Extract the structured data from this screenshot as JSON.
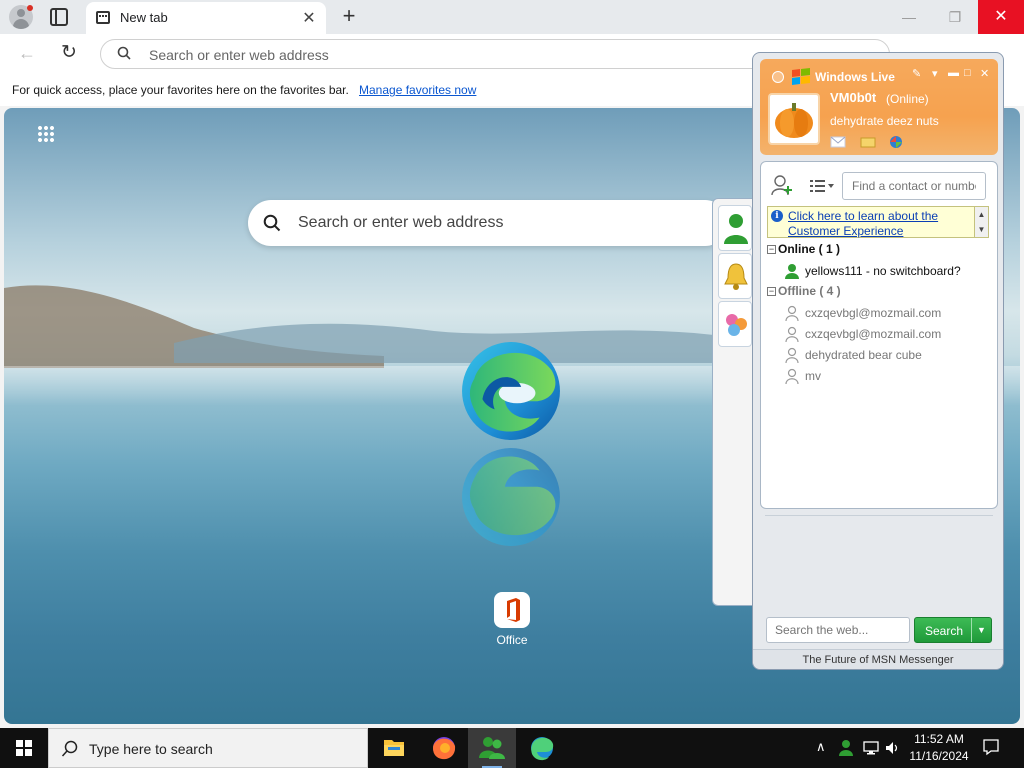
{
  "browser": {
    "tab_title": "New tab",
    "tab_close": "✕",
    "new_tab": "+",
    "win_min": "—",
    "win_max": "❐",
    "win_close": "✕",
    "address_placeholder": "Search or enter web address",
    "favorites_message": "For quick access, place your favorites here on the favorites bar.",
    "favorites_link": "Manage favorites now"
  },
  "ntp": {
    "search_placeholder": "Search or enter web address",
    "tiles": [
      {
        "label": "Office",
        "icon": "office-icon"
      }
    ]
  },
  "messenger": {
    "title": "Windows Live",
    "ctrl_dropdown": "▾",
    "ctrl_min": "▬",
    "ctrl_max": "□",
    "ctrl_close": "✕",
    "display_name": "VM0b0t",
    "status": "(Online)",
    "personal_message": "dehydrate deez nuts",
    "find_placeholder": "Find a contact or numbe",
    "info_link": "Click here to learn about the Customer Experience",
    "groups": [
      {
        "label": "Online ( 1 )",
        "toggle": "−",
        "contacts": [
          {
            "name": "yellows111 - no switchboard?",
            "state": "online"
          }
        ]
      },
      {
        "label": "Offline ( 4 )",
        "toggle": "−",
        "contacts": [
          {
            "name": "cxzqevbgl@mozmail.com",
            "state": "offline"
          },
          {
            "name": "cxzqevbgl@mozmail.com",
            "state": "offline"
          },
          {
            "name": "dehydrated bear cube",
            "state": "offline"
          },
          {
            "name": "mv",
            "state": "offline"
          }
        ]
      }
    ],
    "web_search_placeholder": "Search the web...",
    "web_search_button": "Search",
    "footer": "The Future of MSN Messenger"
  },
  "taskbar": {
    "search_placeholder": "Type here to search",
    "apps": [
      "file-explorer-icon",
      "firefox-icon",
      "messenger-icon",
      "edge-icon"
    ],
    "time": "11:52 AM",
    "date": "11/16/2024"
  },
  "colors": {
    "messenger_header": "#f6a24f",
    "link": "#0b57d0",
    "search_button": "#1f9a3a",
    "close_button": "#e81123"
  }
}
